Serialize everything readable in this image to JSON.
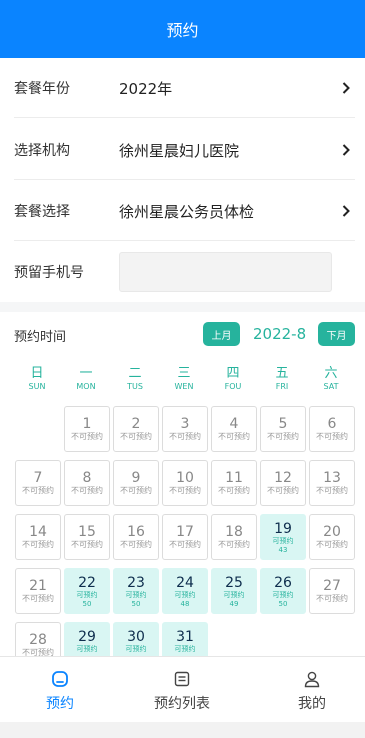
{
  "header": {
    "title": "预约"
  },
  "form": {
    "year": {
      "label": "套餐年份",
      "value": "2022年"
    },
    "institution": {
      "label": "选择机构",
      "value": "徐州星晨妇儿医院"
    },
    "package": {
      "label": "套餐选择",
      "value": "徐州星晨公务员体检"
    },
    "phone": {
      "label": "预留手机号",
      "value": "",
      "placeholder": ""
    }
  },
  "schedule": {
    "label": "预约时间",
    "prev_label": "上月",
    "next_label": "下月",
    "month": "2022-8"
  },
  "weekdays": [
    {
      "cn": "日",
      "en": "SUN"
    },
    {
      "cn": "一",
      "en": "MON"
    },
    {
      "cn": "二",
      "en": "TUS"
    },
    {
      "cn": "三",
      "en": "WEN"
    },
    {
      "cn": "四",
      "en": "FOU"
    },
    {
      "cn": "五",
      "en": "FRI"
    },
    {
      "cn": "六",
      "en": "SAT"
    }
  ],
  "days": [
    {
      "day": "1",
      "status": "不可预约"
    },
    {
      "day": "2",
      "status": "不可预约"
    },
    {
      "day": "3",
      "status": "不可预约"
    },
    {
      "day": "4",
      "status": "不可预约"
    },
    {
      "day": "5",
      "status": "不可预约"
    },
    {
      "day": "6",
      "status": "不可预约"
    },
    {
      "day": "7",
      "status": "不可预约"
    },
    {
      "day": "8",
      "status": "不可预约"
    },
    {
      "day": "9",
      "status": "不可预约"
    },
    {
      "day": "10",
      "status": "不可预约"
    },
    {
      "day": "11",
      "status": "不可预约"
    },
    {
      "day": "12",
      "status": "不可预约"
    },
    {
      "day": "13",
      "status": "不可预约"
    },
    {
      "day": "14",
      "status": "不可预约"
    },
    {
      "day": "15",
      "status": "不可预约"
    },
    {
      "day": "16",
      "status": "不可预约"
    },
    {
      "day": "17",
      "status": "不可预约"
    },
    {
      "day": "18",
      "status": "不可预约"
    },
    {
      "day": "19",
      "status": "可预约",
      "count": "43"
    },
    {
      "day": "20",
      "status": "不可预约"
    },
    {
      "day": "21",
      "status": "不可预约"
    },
    {
      "day": "22",
      "status": "可预约",
      "count": "50"
    },
    {
      "day": "23",
      "status": "可预约",
      "count": "50"
    },
    {
      "day": "24",
      "status": "可预约",
      "count": "48"
    },
    {
      "day": "25",
      "status": "可预约",
      "count": "49"
    },
    {
      "day": "26",
      "status": "可预约",
      "count": "50"
    },
    {
      "day": "27",
      "status": "不可预约"
    },
    {
      "day": "28",
      "status": "不可预约"
    },
    {
      "day": "29",
      "status": "可预约"
    },
    {
      "day": "30",
      "status": "可预约"
    },
    {
      "day": "31",
      "status": "可预约"
    }
  ],
  "first_weekday_index": 1,
  "tabs": [
    {
      "label": "预约",
      "icon": "home-icon",
      "active": true
    },
    {
      "label": "预约列表",
      "icon": "list-icon",
      "active": false
    },
    {
      "label": "我的",
      "icon": "user-icon",
      "active": false
    }
  ],
  "colors": {
    "primary": "#0a84ff",
    "accent": "#26b39d",
    "available_bg": "#d9f6f3"
  }
}
